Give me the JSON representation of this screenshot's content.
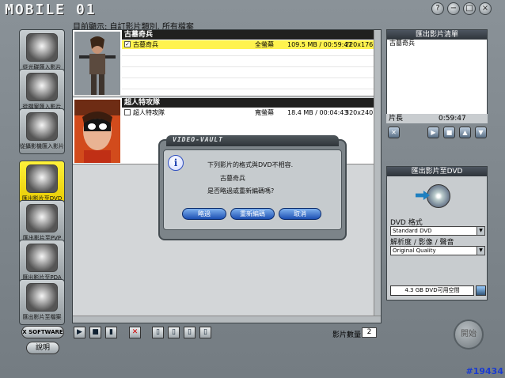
{
  "app": {
    "logo": "MOBILE 01",
    "status": "目前顯示: 自訂影片類別, 所有檔案",
    "window_buttons": [
      "?",
      "−",
      "□",
      "×"
    ],
    "watermark": "#19434"
  },
  "sidebar": {
    "items": [
      {
        "label": "從光碟匯入影片",
        "icon": "disc-import-icon"
      },
      {
        "label": "從檔案匯入影片",
        "icon": "file-import-icon"
      },
      {
        "label": "從攝影機匯入影片",
        "icon": "camcorder-import-icon"
      },
      {
        "label": "匯出影片至DVD",
        "icon": "dvd-export-icon"
      },
      {
        "label": "匯出影片至PVP",
        "icon": "pvp-export-icon"
      },
      {
        "label": "匯出影片至PDA",
        "icon": "pda-export-icon"
      },
      {
        "label": "匯出影片至檔案",
        "icon": "file-export-icon"
      }
    ],
    "xsoftware": "X SOFTWARE",
    "help": "說明"
  },
  "movies": [
    {
      "title": "古墓奇兵",
      "rec_name": "古墓奇兵",
      "format": "全螢幕",
      "size_time": "109.5 MB / 00:59:47",
      "res": "220x176 /",
      "checked": "✓"
    },
    {
      "title": "超人特攻隊",
      "rec_name": "超人特攻隊",
      "format": "寬螢幕",
      "size_time": "18.4 MB / 00:04:43",
      "res": "320x240 /",
      "checked": ""
    }
  ],
  "bottom": {
    "count_label": "影片數量",
    "count": "2"
  },
  "outlist": {
    "title": "匯出影片清單",
    "items": [
      "古墓奇兵"
    ],
    "len_label": "片長",
    "len_value": "0:59:47"
  },
  "dvd": {
    "title": "匯出影片至DVD",
    "format_label": "DVD 格式",
    "format_value": "Standard DVD",
    "quality_label": "解析度 / 影像 / 聲音",
    "quality_value": "Original Quality",
    "space": "4.3 GB DVD可用空間",
    "start": "開始"
  },
  "dialog": {
    "title": "VIDEO-VAULT",
    "line1": "下列影片的格式與DVD不相容.",
    "line2": "古墓奇兵",
    "line3": "是否略過或重新編碼嗎?",
    "skip": "略過",
    "reencode": "重新編碼",
    "cancel": "取消"
  }
}
